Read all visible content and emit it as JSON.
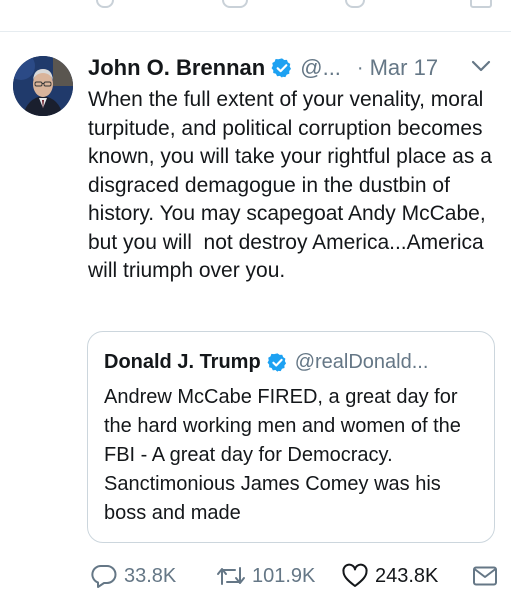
{
  "tweet": {
    "author_name": "John O. Brennan",
    "handle": "@...",
    "separator": "·",
    "date": "Mar 17",
    "text": "When the full extent of your venality, moral turpitude, and political corruption becomes known, you will take your rightful place as a disgraced demagogue in the dustbin of history. You may scapegoat Andy McCabe, but you will  not destroy America...America will triumph over you."
  },
  "quoted_tweet": {
    "author_name": "Donald J. Trump",
    "handle": "@realDonald...",
    "text": "Andrew McCabe FIRED, a great day for the hard working men and women of the FBI - A great day for Democracy. Sanctimonious James Comey was his boss and made"
  },
  "actions": {
    "replies": "33.8K",
    "retweets": "101.9K",
    "likes": "243.8K"
  },
  "colors": {
    "verified_blue": "#1da1f2",
    "secondary_text": "#657786",
    "primary_text": "#14171a",
    "border": "#ccd6dd"
  },
  "icons": {
    "verified": "verified-badge-icon",
    "caret": "chevron-down-icon",
    "reply": "reply-icon",
    "retweet": "retweet-icon",
    "like": "heart-icon",
    "message": "direct-message-icon"
  }
}
